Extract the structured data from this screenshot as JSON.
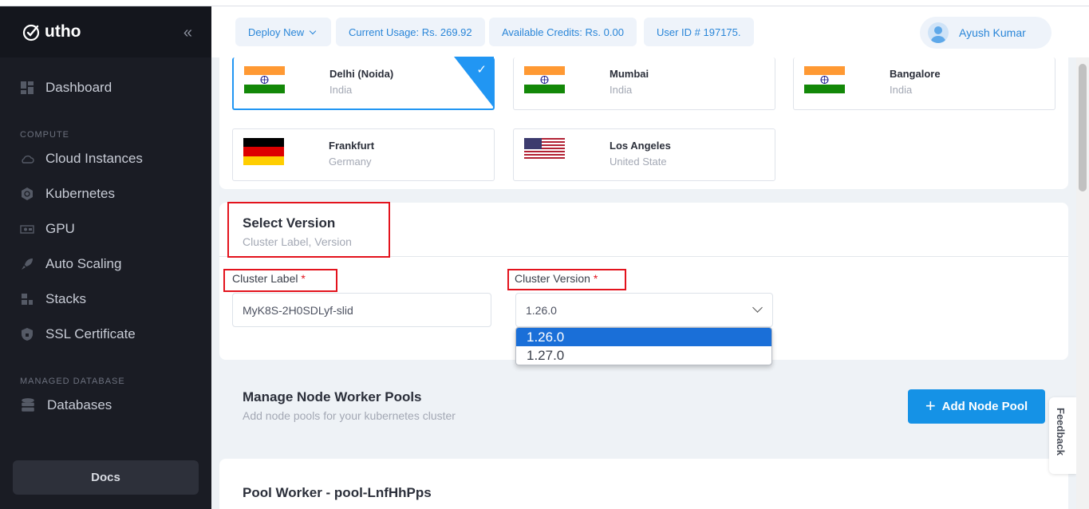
{
  "app": {
    "name": "utho"
  },
  "sidebar": {
    "items": [
      {
        "label": "Dashboard",
        "icon": "dashboard-icon"
      },
      {
        "label": "Cloud Instances",
        "icon": "cloud-icon"
      },
      {
        "label": "Kubernetes",
        "icon": "kubernetes-icon"
      },
      {
        "label": "GPU",
        "icon": "gpu-icon"
      },
      {
        "label": "Auto Scaling",
        "icon": "rocket-icon"
      },
      {
        "label": "Stacks",
        "icon": "stacks-icon"
      },
      {
        "label": "SSL Certificate",
        "icon": "shield-icon"
      },
      {
        "label": "Databases",
        "icon": "database-icon"
      }
    ],
    "section_compute": "COMPUTE",
    "section_managed_db": "MANAGED DATABASE",
    "docs_label": "Docs"
  },
  "header": {
    "deploy_new": "Deploy New",
    "current_usage": "Current Usage: Rs. 269.92",
    "available_credits": "Available Credits: Rs. 0.00",
    "user_id": "User ID # 197175.",
    "user_name": "Ayush Kumar"
  },
  "locations": [
    {
      "name": "Delhi (Noida)",
      "country": "India",
      "flag": "india",
      "selected": true
    },
    {
      "name": "Mumbai",
      "country": "India",
      "flag": "india",
      "selected": false
    },
    {
      "name": "Bangalore",
      "country": "India",
      "flag": "india",
      "selected": false
    },
    {
      "name": "Frankfurt",
      "country": "Germany",
      "flag": "germany",
      "selected": false
    },
    {
      "name": "Los Angeles",
      "country": "United State",
      "flag": "usa",
      "selected": false
    }
  ],
  "select_version": {
    "title": "Select Version",
    "subtitle": "Cluster Label, Version",
    "cluster_label_label": "Cluster Label",
    "cluster_label_value": "MyK8S-2H0SDLyf-slid",
    "cluster_version_label": "Cluster Version",
    "required_mark": "*",
    "cluster_version_value": "1.26.0",
    "version_options": [
      "1.26.0",
      "1.27.0"
    ],
    "highlighted_option": "1.26.0"
  },
  "node_pools": {
    "title": "Manage Node Worker Pools",
    "subtitle": "Add node pools for your kubernetes cluster",
    "add_button": "Add Node Pool",
    "pool_title": "Pool Worker - pool-LnfHhPps"
  },
  "feedback_label": "Feedback",
  "colors": {
    "accent": "#1592e6",
    "sidebar_bg": "#1a1c24",
    "highlight_red": "#e3131d"
  }
}
